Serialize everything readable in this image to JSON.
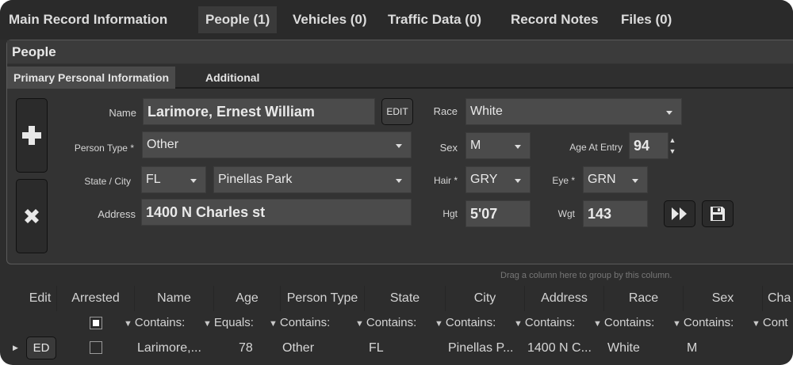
{
  "tabs": [
    {
      "label": "Main Record Information"
    },
    {
      "label": "People (1)"
    },
    {
      "label": "Vehicles (0)"
    },
    {
      "label": "Traffic Data (0)"
    },
    {
      "label": "Record Notes"
    },
    {
      "label": "Files (0)"
    }
  ],
  "people_panel": {
    "title": "People",
    "subtabs": [
      {
        "label": "Primary Personal Information"
      },
      {
        "label": "Additional"
      }
    ],
    "add_icon": "plus-icon",
    "delete_icon": "close-x-icon",
    "form": {
      "name_label": "Name",
      "name_value": "Larimore, Ernest William",
      "edit_label": "EDIT",
      "race_label": "Race",
      "race_value": "White",
      "person_type_label": "Person Type *",
      "person_type_value": "Other",
      "sex_label": "Sex",
      "sex_value": "M",
      "age_label": "Age At Entry",
      "age_value": "94",
      "state_city_label": "State / City",
      "state_value": "FL",
      "city_value": "Pinellas Park",
      "hair_label": "Hair *",
      "hair_value": "GRY",
      "eye_label": "Eye *",
      "eye_value": "GRN",
      "address_label": "Address",
      "address_value": "1400 N Charles st",
      "hgt_label": "Hgt",
      "hgt_value": "5'07",
      "wgt_label": "Wgt",
      "wgt_value": "143"
    },
    "next_icon": "fast-forward-icon",
    "save_icon": "floppy-disk-icon"
  },
  "grid": {
    "group_hint": "Drag a column here to group by this column.",
    "columns": [
      "Edit",
      "Arrested",
      "Name",
      "Age",
      "Person Type",
      "State",
      "City",
      "Address",
      "Race",
      "Sex",
      "Cha"
    ],
    "filters": {
      "name": "Contains:",
      "age": "Equals:",
      "person_type": "Contains:",
      "state": "Contains:",
      "city": "Contains:",
      "address": "Contains:",
      "race": "Contains:",
      "sex": "Contains:",
      "cha": "Cont"
    },
    "rows": [
      {
        "edit": "ED",
        "name": "Larimore,...",
        "age": "78",
        "person_type": "Other",
        "state": "FL",
        "city": "Pinellas P...",
        "address": "1400 N C...",
        "race": "White",
        "sex": "M"
      }
    ]
  },
  "colors": {
    "background": "#2d2d2d",
    "field": "#4b4b4b",
    "text": "#e6e6e6"
  }
}
